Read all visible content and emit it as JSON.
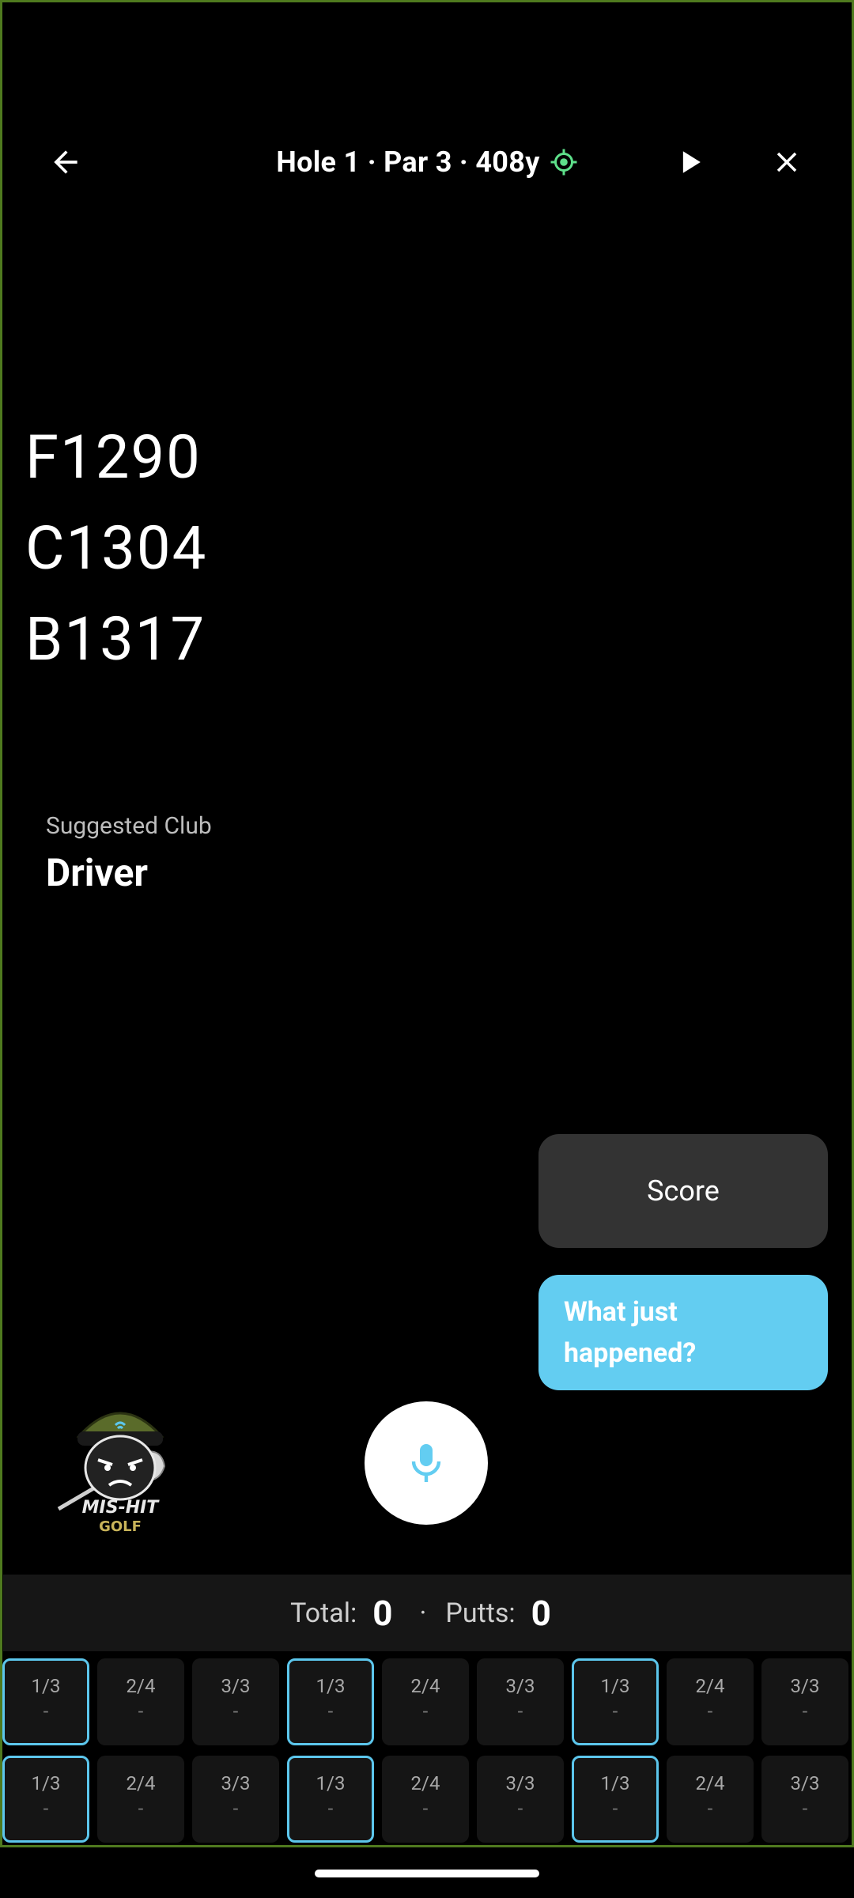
{
  "header": {
    "title": "Hole 1 · Par 3 · 408y",
    "gps_color": "#5ee08a"
  },
  "distances": {
    "front": "F1290",
    "center": "C1304",
    "back": "B1317"
  },
  "suggested": {
    "label": "Suggested Club",
    "club": "Driver"
  },
  "actions": {
    "score_label": "Score",
    "what_happened_label": "What just happened?"
  },
  "logo": {
    "line1": "MIS-HIT",
    "line2": "GOLF"
  },
  "totals": {
    "total_label": "Total:",
    "total_value": "0",
    "separator": "·",
    "putts_label": "Putts:",
    "putts_value": "0"
  },
  "grid": {
    "row1": [
      {
        "ratio": "1/3",
        "value": "-",
        "highlight": true
      },
      {
        "ratio": "2/4",
        "value": "-",
        "highlight": false
      },
      {
        "ratio": "3/3",
        "value": "-",
        "highlight": false
      },
      {
        "ratio": "1/3",
        "value": "-",
        "highlight": true
      },
      {
        "ratio": "2/4",
        "value": "-",
        "highlight": false
      },
      {
        "ratio": "3/3",
        "value": "-",
        "highlight": false
      },
      {
        "ratio": "1/3",
        "value": "-",
        "highlight": true
      },
      {
        "ratio": "2/4",
        "value": "-",
        "highlight": false
      },
      {
        "ratio": "3/3",
        "value": "-",
        "highlight": false
      }
    ],
    "row2": [
      {
        "ratio": "1/3",
        "value": "-",
        "highlight": true
      },
      {
        "ratio": "2/4",
        "value": "-",
        "highlight": false
      },
      {
        "ratio": "3/3",
        "value": "-",
        "highlight": false
      },
      {
        "ratio": "1/3",
        "value": "-",
        "highlight": true
      },
      {
        "ratio": "2/4",
        "value": "-",
        "highlight": false
      },
      {
        "ratio": "3/3",
        "value": "-",
        "highlight": false
      },
      {
        "ratio": "1/3",
        "value": "-",
        "highlight": true
      },
      {
        "ratio": "2/4",
        "value": "-",
        "highlight": false
      },
      {
        "ratio": "3/3",
        "value": "-",
        "highlight": false
      }
    ]
  },
  "icons": {
    "back": "arrow-left-icon",
    "play": "play-icon",
    "close": "close-icon",
    "gps": "gps-target-icon",
    "mic": "microphone-icon"
  },
  "colors": {
    "accent": "#63cdf1",
    "background": "#000000",
    "score_button": "#333333"
  }
}
